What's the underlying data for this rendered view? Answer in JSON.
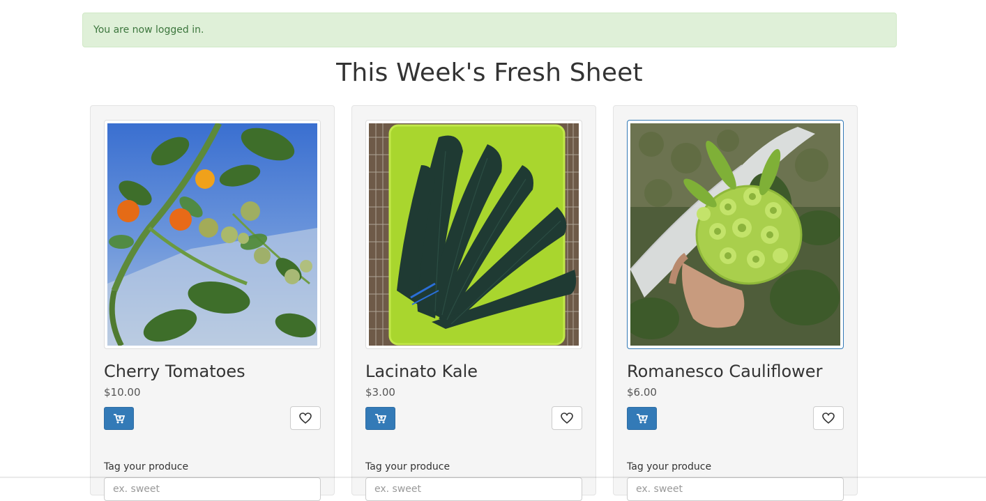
{
  "alert": {
    "message": "You are now logged in.",
    "color": "#dff0d8"
  },
  "page": {
    "title": "This Week's Fresh Sheet"
  },
  "products": [
    {
      "name": "Cherry Tomatoes",
      "price": "$10.00",
      "image_icon": "cherry-tomatoes-photo",
      "tag_label": "Tag your produce",
      "tag_placeholder": "ex. sweet"
    },
    {
      "name": "Lacinato Kale",
      "price": "$3.00",
      "image_icon": "lacinato-kale-photo",
      "tag_label": "Tag your produce",
      "tag_placeholder": "ex. sweet"
    },
    {
      "name": "Romanesco Cauliflower",
      "price": "$6.00",
      "image_icon": "romanesco-cauliflower-photo",
      "tag_label": "Tag your produce",
      "tag_placeholder": "ex. sweet"
    }
  ],
  "colors": {
    "primary": "#337ab7",
    "card_bg": "#f5f5f5"
  },
  "icons": {
    "add_to_cart": "cart-plus-icon",
    "favorite": "heart-outline-icon"
  }
}
